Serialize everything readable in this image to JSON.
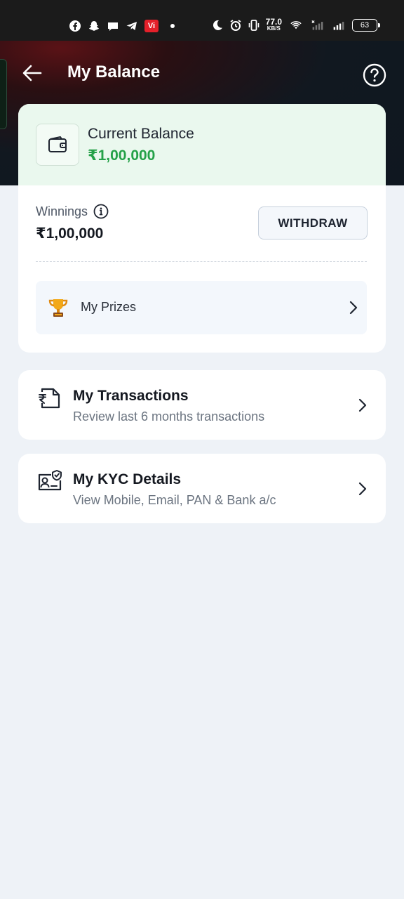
{
  "status_bar": {
    "carrier_badge": "Vi",
    "net_speed": "77.0",
    "net_speed_unit": "KB/S",
    "battery": "63",
    "icons": [
      "facebook-icon",
      "snapchat-icon",
      "chat-icon",
      "telegram-icon",
      "vi-icon",
      "moon-icon",
      "alarm-icon",
      "vibrate-icon",
      "wifi-icon",
      "signal-icon",
      "battery-icon"
    ]
  },
  "header": {
    "title": "My Balance",
    "back_icon": "arrow-left-icon",
    "help_icon": "help-circle-icon"
  },
  "balance_card": {
    "current_label": "Current Balance",
    "current_amount": "₹1,00,000",
    "winnings_label": "Winnings",
    "winnings_amount": "₹1,00,000",
    "withdraw_label": "WITHDRAW",
    "prizes_label": "My Prizes"
  },
  "menu": {
    "transactions": {
      "title": "My Transactions",
      "subtitle": "Review last 6 months transactions"
    },
    "kyc": {
      "title": "My KYC Details",
      "subtitle": "View Mobile, Email, PAN & Bank a/c"
    }
  },
  "colors": {
    "accent_green": "#24a148",
    "page_bg": "#eef2f7",
    "header_dark": "#111820"
  }
}
